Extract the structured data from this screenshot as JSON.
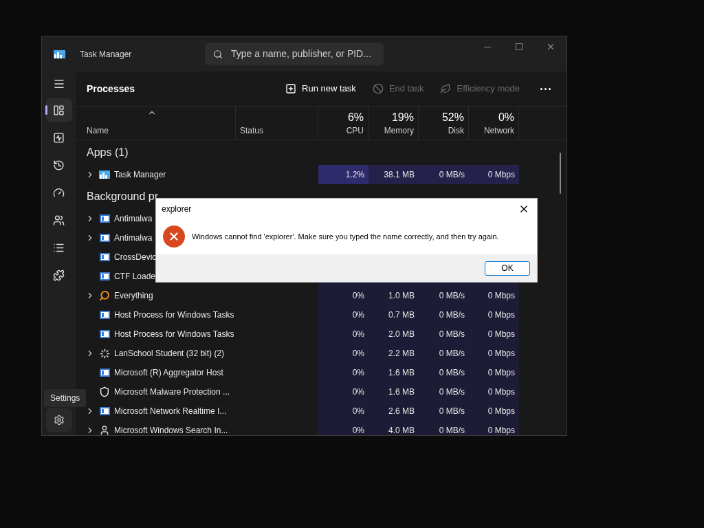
{
  "window": {
    "title": "Task Manager"
  },
  "search": {
    "placeholder": "Type a name, publisher, or PID..."
  },
  "sidebar": {
    "items": [
      {
        "selected": true
      },
      {
        "selected": false
      },
      {
        "selected": false
      },
      {
        "selected": false
      },
      {
        "selected": false
      },
      {
        "selected": false
      },
      {
        "selected": false
      }
    ],
    "settings_tooltip": "Settings"
  },
  "toolbar": {
    "title": "Processes",
    "actions": [
      {
        "label": "Run new task",
        "disabled": false
      },
      {
        "label": "End task",
        "disabled": true
      },
      {
        "label": "Efficiency mode",
        "disabled": true
      }
    ]
  },
  "table": {
    "columns": [
      {
        "label": "Name"
      },
      {
        "label": "Status"
      },
      {
        "percent": "6%",
        "label": "CPU"
      },
      {
        "percent": "19%",
        "label": "Memory"
      },
      {
        "percent": "52%",
        "label": "Disk"
      },
      {
        "percent": "0%",
        "label": "Network"
      }
    ],
    "groups": [
      {
        "heading": "Apps (1)",
        "rows": [
          {
            "name": "Task Manager",
            "kind": "taskmanager",
            "expandable": true,
            "highlighted": true,
            "cpu": "1.2%",
            "memory": "38.1 MB",
            "disk": "0 MB/s",
            "network": "0 Mbps"
          }
        ]
      },
      {
        "heading": "Background pr",
        "rows": [
          {
            "name": "Antimalwa",
            "kind": "service",
            "expandable": true
          },
          {
            "name": "Antimalwa",
            "kind": "service",
            "expandable": true
          },
          {
            "name": "CrossDevic",
            "kind": "service",
            "expandable": false
          },
          {
            "name": "CTF Loade",
            "kind": "service",
            "expandable": false
          },
          {
            "name": "Everything",
            "kind": "magnifier",
            "expandable": true,
            "cpu": "0%",
            "memory": "1.0 MB",
            "disk": "0 MB/s",
            "network": "0 Mbps"
          },
          {
            "name": "Host Process for Windows Tasks",
            "kind": "service",
            "expandable": false,
            "cpu": "0%",
            "memory": "0.7 MB",
            "disk": "0 MB/s",
            "network": "0 Mbps"
          },
          {
            "name": "Host Process for Windows Tasks",
            "kind": "service",
            "expandable": false,
            "cpu": "0%",
            "memory": "2.0 MB",
            "disk": "0 MB/s",
            "network": "0 Mbps"
          },
          {
            "name": "LanSchool Student (32 bit) (2)",
            "kind": "spinner",
            "expandable": true,
            "cpu": "0%",
            "memory": "2.2 MB",
            "disk": "0 MB/s",
            "network": "0 Mbps"
          },
          {
            "name": "Microsoft (R) Aggregator Host",
            "kind": "service",
            "expandable": false,
            "cpu": "0%",
            "memory": "1.6 MB",
            "disk": "0 MB/s",
            "network": "0 Mbps"
          },
          {
            "name": "Microsoft Malware Protection ...",
            "kind": "shield",
            "expandable": false,
            "cpu": "0%",
            "memory": "1.6 MB",
            "disk": "0 MB/s",
            "network": "0 Mbps"
          },
          {
            "name": "Microsoft Network Realtime I...",
            "kind": "service",
            "expandable": true,
            "cpu": "0%",
            "memory": "2.6 MB",
            "disk": "0 MB/s",
            "network": "0 Mbps"
          },
          {
            "name": "Microsoft Windows Search In...",
            "kind": "person",
            "expandable": true,
            "cpu": "0%",
            "memory": "4.0 MB",
            "disk": "0 MB/s",
            "network": "0 Mbps"
          }
        ]
      }
    ]
  },
  "dialog": {
    "title": "explorer",
    "message": "Windows cannot find 'explorer'. Make sure you typed the name correctly, and then try again.",
    "button": "OK"
  }
}
